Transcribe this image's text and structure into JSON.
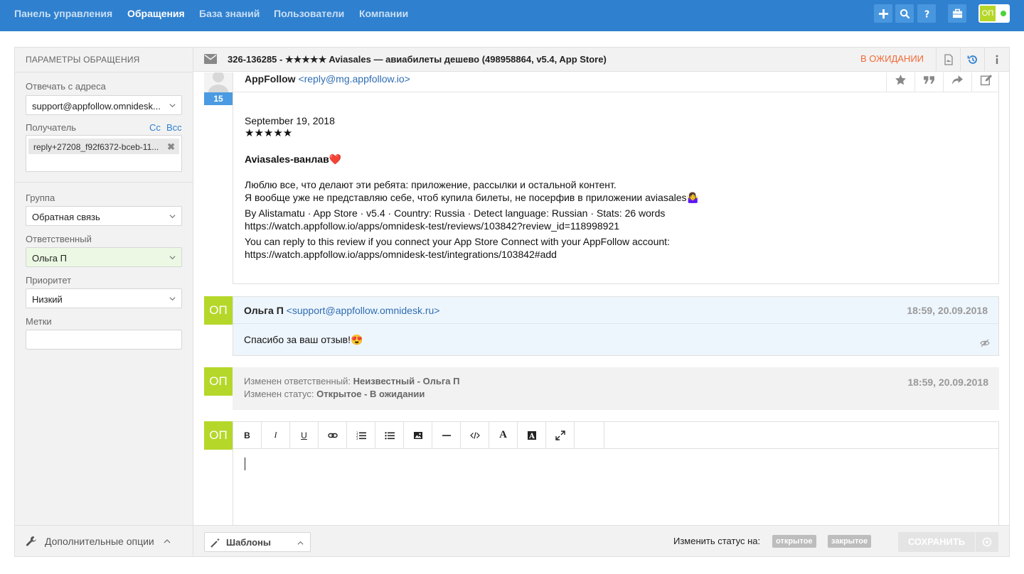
{
  "nav": {
    "items": [
      "Панель управления",
      "Обращения",
      "База знаний",
      "Пользователи",
      "Компании"
    ],
    "active_index": 1,
    "icons": [
      "plus-icon",
      "search-icon",
      "help-icon",
      "briefcase-icon"
    ],
    "user_initials": "ОП",
    "online": true
  },
  "sidebar": {
    "title": "ПАРАМЕТРЫ ОБРАЩЕНИЯ",
    "reply_from_label": "Отвечать с адреса",
    "reply_from_value": "support@appfollow.omnidesk...",
    "recipient_label": "Получатель",
    "cc": "Cc",
    "bcc": "Bcc",
    "recipient_value": "reply+27208_f92f6372-bceb-11...",
    "group_label": "Группа",
    "group_value": "Обратная связь",
    "assignee_label": "Ответственный",
    "assignee_value": "Ольга П",
    "priority_label": "Приоритет",
    "priority_value": "Низкий",
    "tags_label": "Метки",
    "tags_value": "",
    "extra_options": "Дополнительные опции"
  },
  "case": {
    "title": "326-136285 - ★★★★★ Aviasales — авиабилеты дешево (498958864, v5.4, App Store)",
    "status": "В ОЖИДАНИИ",
    "status_color": "#f06a35"
  },
  "messages": {
    "first": {
      "day": "15",
      "sender_name": "AppFollow",
      "sender_email": "<reply@mg.appfollow.io>",
      "date": "September 19, 2018",
      "stars": "★★★★★",
      "heading": "Aviasales-ванлав❤️",
      "line1": "Люблю все, что делают эти ребята: приложение, рассылки и остальной контент.",
      "line2": "Я вообще уже не представляю себе, чтоб купила билеты, не посерфив в приложении aviasales🤷‍♀️",
      "meta": "By Alistamatu · App Store · v5.4 · Country: Russia · Detect language: Russian · Stats: 26 words",
      "review_url": "https://watch.appfollow.io/apps/omnidesk-test/reviews/103842?review_id=118998921",
      "connect_text": "You can reply to this review if you connect your App Store Connect with your AppFollow account:",
      "connect_url": "https://watch.appfollow.io/apps/omnidesk-test/integrations/103842#add"
    },
    "reply": {
      "initials": "ОП",
      "sender_name": "Ольга П",
      "sender_email": "<support@appfollow.omnidesk.ru>",
      "time": "18:59, 20.09.2018",
      "text": "Спасибо за ваш отзыв!😍"
    },
    "system": {
      "initials": "ОП",
      "line1_label": "Изменен ответственный: ",
      "line1_value": "Неизвестный - Ольга П",
      "line2_label": "Изменен статус: ",
      "line2_value": "Открытое - В ожидании",
      "time": "18:59, 20.09.2018"
    }
  },
  "editor": {
    "initials": "ОП",
    "tools": [
      "B",
      "I",
      "U",
      "link",
      "ordered-list",
      "bullet-list",
      "image",
      "hr",
      "code",
      "font",
      "font-color",
      "fullscreen",
      ""
    ],
    "value": ""
  },
  "footer": {
    "templates": "Шаблоны",
    "change_status_label": "Изменить статус на:",
    "status_open": "открытое",
    "status_closed": "закрытое",
    "save": "СОХРАНИТЬ"
  },
  "colors": {
    "topbar": "#2f80cf",
    "accent": "#2f80cf",
    "avatar": "#b5d72a",
    "badge": "#4a9be1"
  }
}
